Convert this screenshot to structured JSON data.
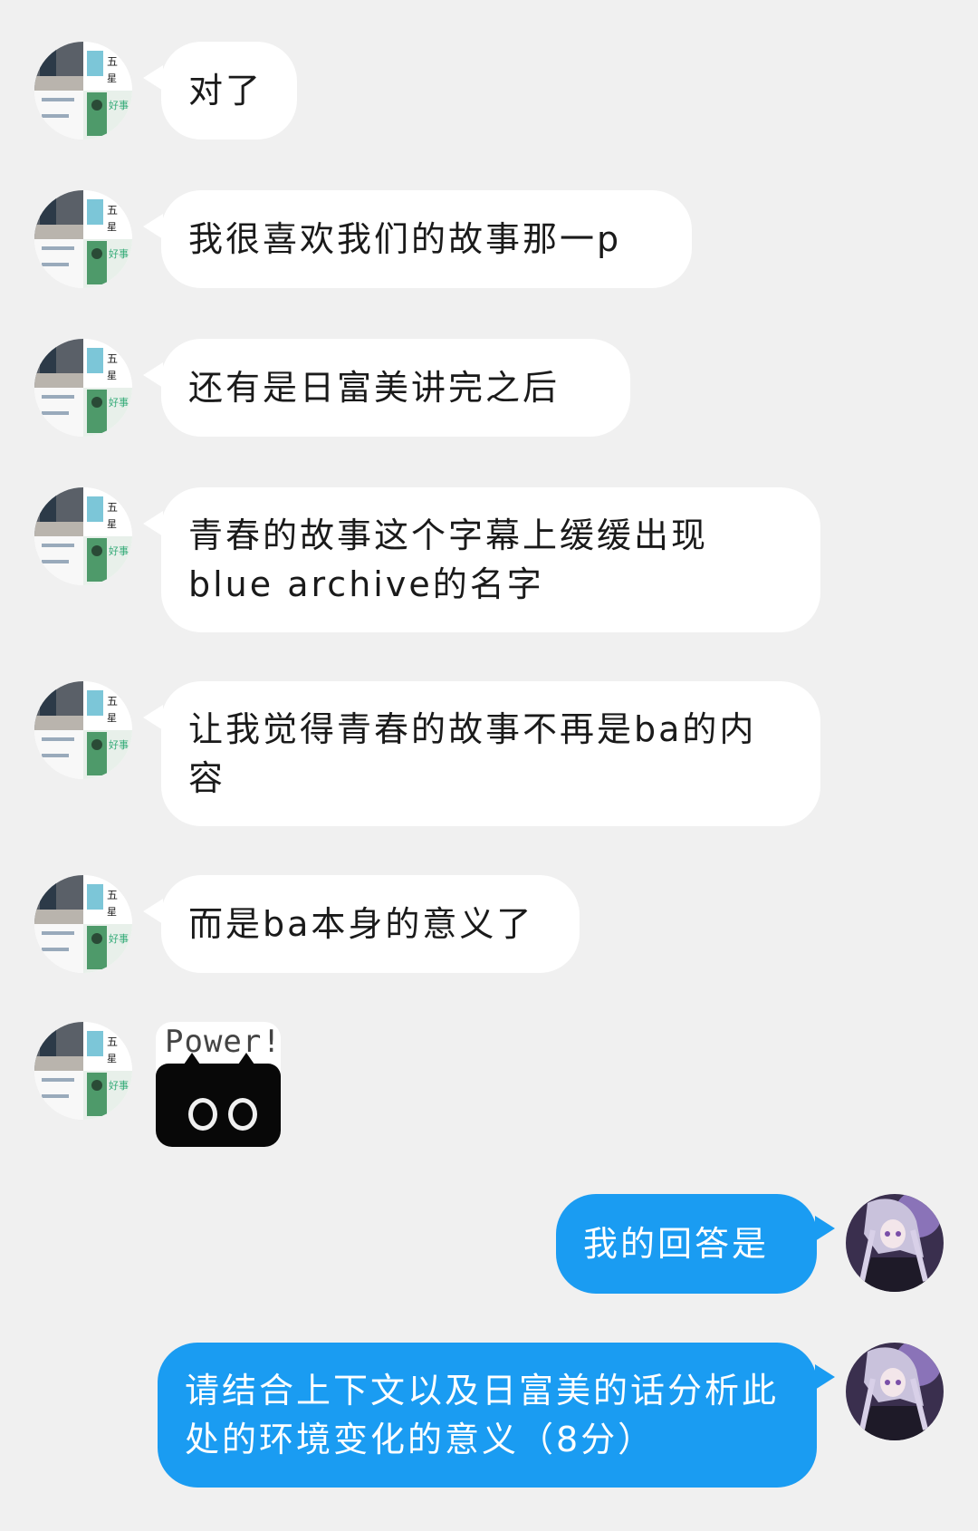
{
  "messages": [
    {
      "side": "left",
      "text": "对了"
    },
    {
      "side": "left",
      "text": "我很喜欢我们的故事那一p"
    },
    {
      "side": "left",
      "text": "还有是日富美讲完之后"
    },
    {
      "side": "left",
      "text": "青春的故事这个字幕上缓缓出现blue archive的名字"
    },
    {
      "side": "left",
      "text": "让我觉得青春的故事不再是ba的内容"
    },
    {
      "side": "left",
      "text": "而是ba本身的意义了"
    },
    {
      "side": "left",
      "sticker": "Power!"
    },
    {
      "side": "right",
      "text": "我的回答是"
    },
    {
      "side": "right",
      "text": "请结合上下文以及日富美的话分析此处的环境变化的意义（8分）"
    }
  ],
  "colors": {
    "background": "#f0f0f0",
    "incoming_bubble": "#ffffff",
    "outgoing_bubble": "#1a9cf2",
    "outgoing_text": "#ffffff"
  },
  "icons": {
    "incoming_avatar": "collage-avatar",
    "outgoing_avatar": "anime-girl-avatar",
    "sticker": "black-cat-power-sticker"
  }
}
